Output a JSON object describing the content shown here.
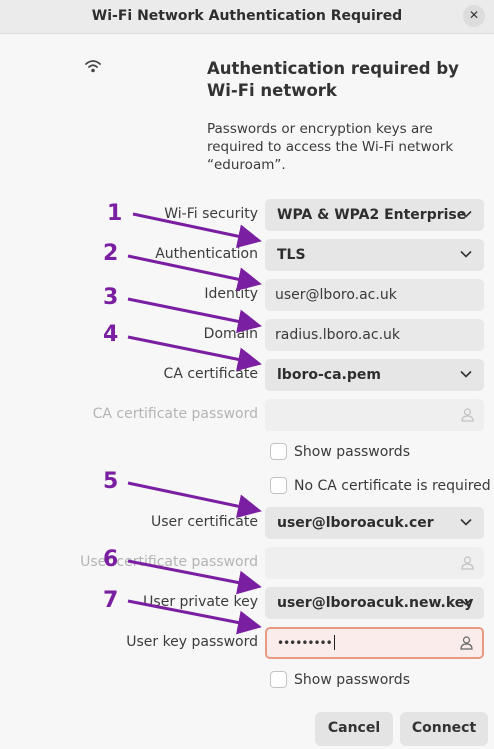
{
  "window": {
    "title": "Wi-Fi Network Authentication Required"
  },
  "header": {
    "heading": "Authentication required by Wi-Fi network",
    "description": "Passwords or encryption keys are required to access the Wi-Fi network “eduroam”."
  },
  "form": {
    "wifi_security": {
      "label": "Wi-Fi security",
      "value": "WPA & WPA2 Enterprise"
    },
    "authentication": {
      "label": "Authentication",
      "value": "TLS"
    },
    "identity": {
      "label": "Identity",
      "value": "user@lboro.ac.uk"
    },
    "domain": {
      "label": "Domain",
      "value": "radius.lboro.ac.uk"
    },
    "ca_certificate": {
      "label": "CA certificate",
      "value": "lboro-ca.pem"
    },
    "ca_certificate_password": {
      "label": "CA certificate password",
      "value": ""
    },
    "show_passwords_1": {
      "label": "Show passwords",
      "checked": false
    },
    "no_ca_required": {
      "label": "No CA certificate is required",
      "checked": false
    },
    "user_certificate": {
      "label": "User certificate",
      "value": "user@lboroacuk.cer"
    },
    "user_certificate_password": {
      "label": "User certificate password",
      "value": ""
    },
    "user_private_key": {
      "label": "User private key",
      "value": "user@lboroacuk.new.key"
    },
    "user_key_password": {
      "label": "User key password",
      "masked_value": "•••••••••"
    },
    "show_passwords_2": {
      "label": "Show passwords",
      "checked": false
    }
  },
  "annotations": [
    "1",
    "2",
    "3",
    "4",
    "5",
    "6",
    "7"
  ],
  "annotation_color": "#7b1fa2",
  "buttons": {
    "cancel": "Cancel",
    "connect": "Connect"
  },
  "icons": {
    "wifi": "wifi-icon",
    "close": "close-icon",
    "chevron": "chevron-down-icon",
    "password": "password-person-icon"
  }
}
